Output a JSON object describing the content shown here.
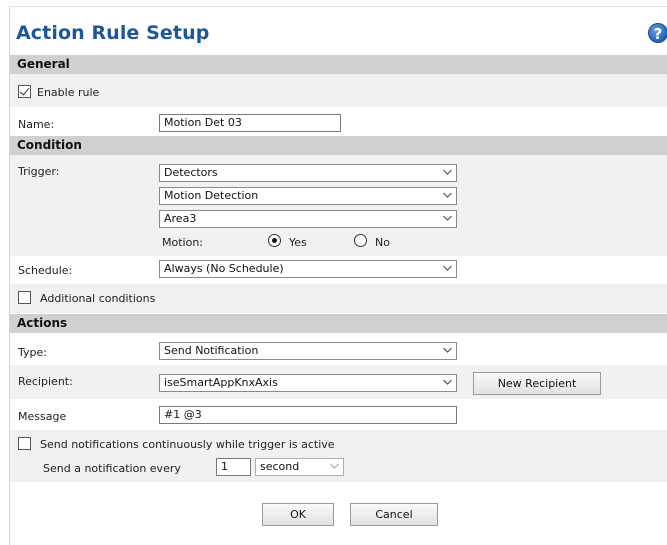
{
  "header": {
    "title": "Action Rule Setup",
    "help_glyph": "?"
  },
  "general": {
    "section_title": "General",
    "enable_rule_label": "Enable rule",
    "enable_rule_checked": true,
    "name_label": "Name:",
    "name_value": "Motion Det 03"
  },
  "condition": {
    "section_title": "Condition",
    "trigger_label": "Trigger:",
    "trigger_values": [
      "Detectors",
      "Motion Detection",
      "Area3"
    ],
    "motion_label": "Motion:",
    "motion_yes": "Yes",
    "motion_no": "No",
    "motion_selected": "Yes",
    "schedule_label": "Schedule:",
    "schedule_value": "Always (No Schedule)",
    "additional_label": "Additional conditions",
    "additional_checked": false
  },
  "actions": {
    "section_title": "Actions",
    "type_label": "Type:",
    "type_value": "Send Notification",
    "recipient_label": "Recipient:",
    "recipient_value": "iseSmartAppKnxAxis",
    "new_recipient_label": "New Recipient",
    "message_label": "Message",
    "message_value": "#1 @3",
    "continuous_label": "Send notifications continuously while trigger is active",
    "continuous_checked": false,
    "every_label": "Send a notification every",
    "every_value": "1",
    "every_unit": "second"
  },
  "footer": {
    "ok_label": "OK",
    "cancel_label": "Cancel"
  }
}
